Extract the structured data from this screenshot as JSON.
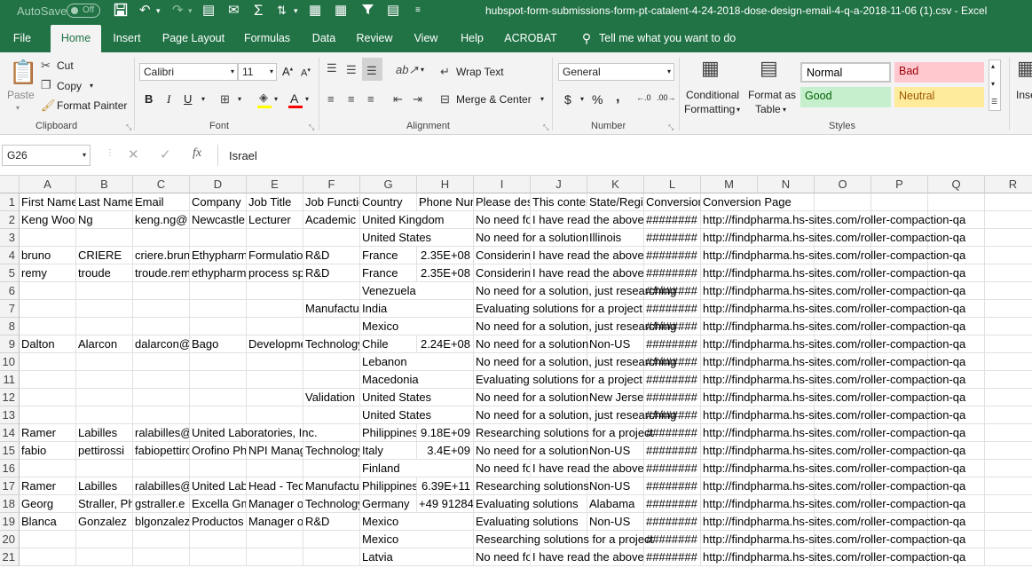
{
  "titlebar": {
    "autosave_label": "AutoSave",
    "autosave_state": "Off",
    "window_title": "hubspot-form-submissions-form-pt-catalent-4-24-2018-dose-design-email-4-q-a-2018-11-06 (1).csv  -  Excel"
  },
  "tabs": [
    "File",
    "Home",
    "Insert",
    "Page Layout",
    "Formulas",
    "Data",
    "Review",
    "View",
    "Help",
    "ACROBAT"
  ],
  "tell_me": "Tell me what you want to do",
  "ribbon": {
    "clipboard": {
      "paste": "Paste",
      "cut": "Cut",
      "copy": "Copy",
      "format_painter": "Format Painter",
      "label": "Clipboard"
    },
    "font": {
      "font_name": "Calibri",
      "font_size": "11",
      "bold": "B",
      "italic": "I",
      "underline": "U",
      "label": "Font"
    },
    "alignment": {
      "wrap_text": "Wrap Text",
      "merge_center": "Merge & Center",
      "label": "Alignment"
    },
    "number": {
      "format": "General",
      "currency": "$",
      "percent": "%",
      "comma": ",",
      "label": "Number"
    },
    "styles": {
      "conditional_1": "Conditional",
      "conditional_2": "Formatting",
      "format_table_1": "Format as",
      "format_table_2": "Table",
      "normal": "Normal",
      "bad": "Bad",
      "good": "Good",
      "neutral": "Neutral",
      "label": "Styles"
    },
    "cells": {
      "insert": "Inse"
    }
  },
  "formula_bar": {
    "name_box": "G26",
    "fx": "fx",
    "value": "Israel"
  },
  "columns": [
    "A",
    "B",
    "C",
    "D",
    "E",
    "F",
    "G",
    "H",
    "I",
    "J",
    "K",
    "L",
    "M",
    "N",
    "O",
    "P",
    "Q",
    "R"
  ],
  "rows": [
    {
      "n": "1",
      "cells": {
        "A": "First Name",
        "B": "Last Name",
        "C": "Email",
        "D": "Company",
        "E": "Job Title",
        "F": "Job Function",
        "G": "Country",
        "H": "Phone Number",
        "I": "Please describe",
        "J": "This content",
        "K": "State/Region",
        "L": "Conversion Date",
        "M": "Conversion Page"
      }
    },
    {
      "n": "2",
      "cells": {
        "A": "Keng Wooi",
        "B": "Ng",
        "C": "keng.ng@",
        "D": "Newcastle",
        "E": "Lecturer",
        "F": "Academic",
        "G": "United Kingdom",
        "I": "No need for a solution",
        "J": "I have read the above",
        "L": "########",
        "M": "http://findpharma.hs-sites.com/roller-compaction-qa"
      }
    },
    {
      "n": "3",
      "cells": {
        "G": "United States",
        "I": "No need for a solution",
        "K": "Illinois",
        "L": "########",
        "M": "http://findpharma.hs-sites.com/roller-compaction-qa"
      }
    },
    {
      "n": "4",
      "cells": {
        "A": "bruno",
        "B": "CRIERE",
        "C": "criere.bruno",
        "D": "Ethypharm",
        "E": "Formulation",
        "F": "R&D",
        "G": "France",
        "H": "2.35E+08",
        "I": "Considering",
        "J": "I have read the above",
        "L": "########",
        "M": "http://findpharma.hs-sites.com/roller-compaction-qa"
      }
    },
    {
      "n": "5",
      "cells": {
        "A": "remy",
        "B": "troude",
        "C": "troude.remy",
        "D": "ethypharm",
        "E": "process specialist",
        "F": "R&D",
        "G": "France",
        "H": "2.35E+08",
        "I": "Considering",
        "J": "I have read the above",
        "L": "########",
        "M": "http://findpharma.hs-sites.com/roller-compaction-qa"
      }
    },
    {
      "n": "6",
      "cells": {
        "G": "Venezuela",
        "I": "No need for a solution, just researching",
        "L": "########",
        "M": "http://findpharma.hs-sites.com/roller-compaction-qa"
      }
    },
    {
      "n": "7",
      "cells": {
        "F": "Manufacturing",
        "G": "India",
        "I": "Evaluating solutions for a project",
        "L": "########",
        "M": "http://findpharma.hs-sites.com/roller-compaction-qa"
      }
    },
    {
      "n": "8",
      "cells": {
        "G": "Mexico",
        "I": "No need for a solution, just researching",
        "L": "########",
        "M": "http://findpharma.hs-sites.com/roller-compaction-qa"
      }
    },
    {
      "n": "9",
      "cells": {
        "A": "Dalton",
        "B": "Alarcon",
        "C": "dalarcon@",
        "D": "Bago",
        "E": "Development",
        "F": "Technology",
        "G": "Chile",
        "H": "2.24E+08",
        "I": "No need for a solution",
        "K": "Non-US",
        "L": "########",
        "M": "http://findpharma.hs-sites.com/roller-compaction-qa"
      }
    },
    {
      "n": "10",
      "cells": {
        "G": "Lebanon",
        "I": "No need for a solution, just researching",
        "L": "########",
        "M": "http://findpharma.hs-sites.com/roller-compaction-qa"
      }
    },
    {
      "n": "11",
      "cells": {
        "G": "Macedonia",
        "I": "Evaluating solutions for a project",
        "L": "########",
        "M": "http://findpharma.hs-sites.com/roller-compaction-qa"
      }
    },
    {
      "n": "12",
      "cells": {
        "F": "Validation",
        "G": "United States",
        "I": "No need for a solution",
        "K": "New Jersey",
        "L": "########",
        "M": "http://findpharma.hs-sites.com/roller-compaction-qa"
      }
    },
    {
      "n": "13",
      "cells": {
        "G": "United States",
        "I": "No need for a solution, just researching",
        "L": "########",
        "M": "http://findpharma.hs-sites.com/roller-compaction-qa"
      }
    },
    {
      "n": "14",
      "cells": {
        "A": "Ramer",
        "B": "Labilles",
        "C": "ralabilles@",
        "D": "United Laboratories, Inc.",
        "G": "Philippines",
        "H": "9.18E+09",
        "I": "Researching solutions for a project",
        "L": "########",
        "M": "http://findpharma.hs-sites.com/roller-compaction-qa"
      }
    },
    {
      "n": "15",
      "cells": {
        "A": "fabio",
        "B": "pettirossi",
        "C": "fabiopettirossi",
        "D": "Orofino Pharma",
        "E": "NPI Manager",
        "F": "Technology",
        "G": "Italy",
        "H": "3.4E+09",
        "I": "No need for a solution",
        "K": "Non-US",
        "L": "########",
        "M": "http://findpharma.hs-sites.com/roller-compaction-qa"
      }
    },
    {
      "n": "16",
      "cells": {
        "G": "Finland",
        "I": "No need for a solution",
        "J": "I have read the above",
        "L": "########",
        "M": "http://findpharma.hs-sites.com/roller-compaction-qa"
      }
    },
    {
      "n": "17",
      "cells": {
        "A": "Ramer",
        "B": "Labilles",
        "C": "ralabilles@",
        "D": "United Labs",
        "E": "Head - Technology",
        "F": "Manufacturing",
        "G": "Philippines",
        "H": "6.39E+11",
        "I": "Researching solutions",
        "K": "Non-US",
        "L": "########",
        "M": "http://findpharma.hs-sites.com/roller-compaction-qa"
      }
    },
    {
      "n": "18",
      "cells": {
        "A": "Georg",
        "B": "Straller, Ph",
        "C": "gstraller.e",
        "D": "Excella GmbH",
        "E": "Manager of",
        "F": "Technology",
        "G": "Germany",
        "H": "+49 91284",
        "I": "Evaluating solutions",
        "K": "Alabama",
        "L": "########",
        "M": "http://findpharma.hs-sites.com/roller-compaction-qa"
      }
    },
    {
      "n": "19",
      "cells": {
        "A": "Blanca",
        "B": "Gonzalez",
        "C": "blgonzalez",
        "D": "Productos",
        "E": "Manager of",
        "F": "R&D",
        "G": "Mexico",
        "I": "Evaluating solutions",
        "K": "Non-US",
        "L": "########",
        "M": "http://findpharma.hs-sites.com/roller-compaction-qa"
      }
    },
    {
      "n": "20",
      "cells": {
        "G": "Mexico",
        "I": "Researching solutions for a project",
        "L": "########",
        "M": "http://findpharma.hs-sites.com/roller-compaction-qa"
      }
    },
    {
      "n": "21",
      "cells": {
        "G": "Latvia",
        "I": "No need for a solution",
        "J": "I have read the above",
        "L": "########",
        "M": "http://findpharma.hs-sites.com/roller-compaction-qa"
      }
    }
  ],
  "colors": {
    "excel_green": "#217346",
    "bad_bg": "#ffc7ce",
    "bad_fg": "#9c0006",
    "good_bg": "#c6efce",
    "good_fg": "#006100",
    "neutral_bg": "#ffeb9c",
    "neutral_fg": "#9c5700"
  }
}
